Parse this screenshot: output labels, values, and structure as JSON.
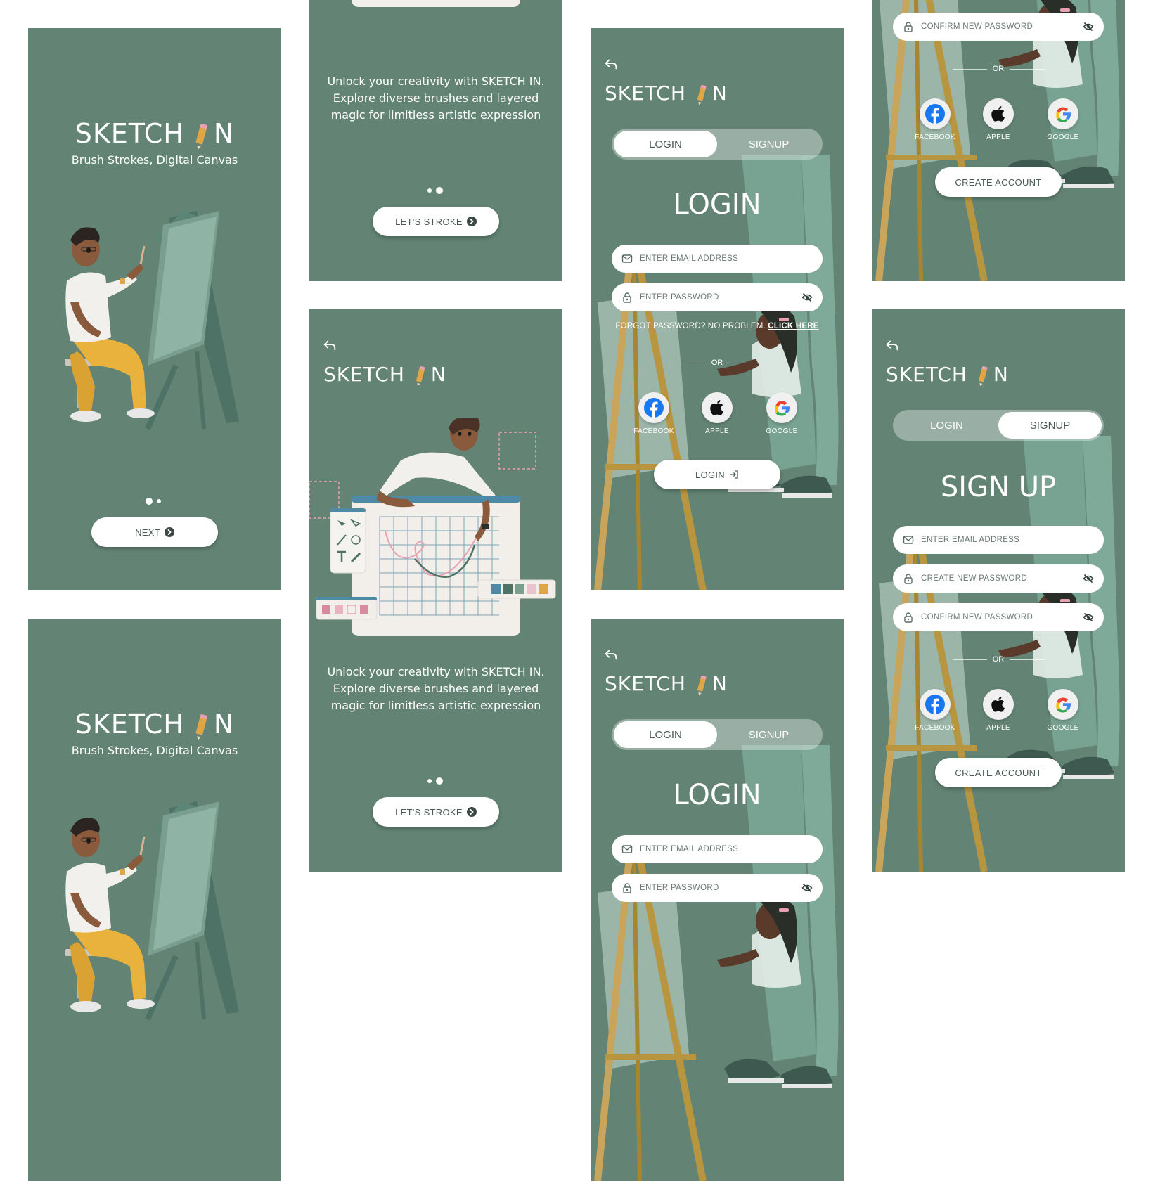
{
  "brand": {
    "name_part1": "SKETCH",
    "name_part2": "N",
    "tagline": "Brush Strokes, Digital Canvas"
  },
  "onboarding": {
    "next_label": "NEXT",
    "description": "Unlock your creativity with SKETCH IN. Explore diverse brushes and layered magic for limitless artistic expression",
    "lets_stroke_label": "LET'S STROKE"
  },
  "auth": {
    "login_tab": "LOGIN",
    "signup_tab": "SIGNUP",
    "login_heading": "LOGIN",
    "signup_heading": "SIGN UP",
    "email_placeholder": "ENTER EMAIL ADDRESS",
    "password_placeholder": "ENTER PASSWORD",
    "create_password_placeholder": "CREATE NEW PASSWORD",
    "confirm_password_placeholder": "CONFIRM NEW PASSWORD",
    "forgot_text": "FORGOT PASSWORD? NO PROBLEM.",
    "click_here": "CLICK HERE",
    "or_text": "OR",
    "facebook": "FACEBOOK",
    "apple": "APPLE",
    "google": "GOOGLE",
    "login_button": "LOGIN",
    "create_account_button": "CREATE ACCOUNT"
  },
  "colors": {
    "background": "#638475",
    "accent_pencil": "#e0a545",
    "white": "#ffffff"
  }
}
